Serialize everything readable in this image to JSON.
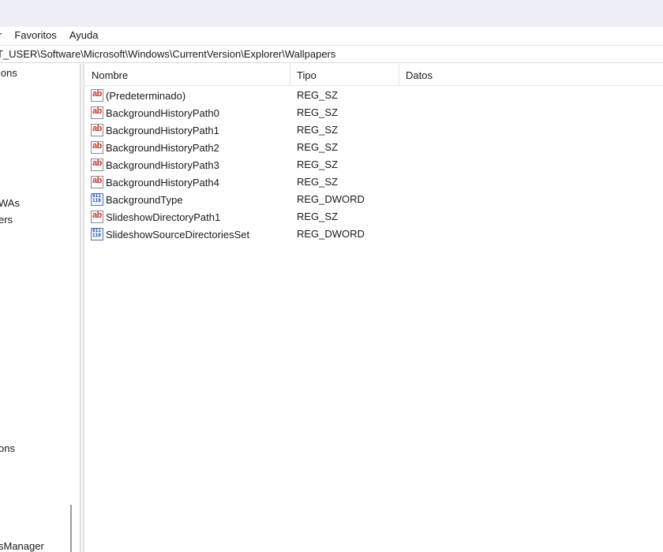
{
  "menu": {
    "items": [
      "r",
      "Favoritos",
      "Ayuda"
    ]
  },
  "address": {
    "path": "T_USER\\Software\\Microsoft\\Windows\\CurrentVersion\\Explorer\\Wallpapers"
  },
  "tree": {
    "items": [
      "ions",
      "WAs",
      "ers",
      "ons",
      "sManager"
    ]
  },
  "list": {
    "headers": {
      "name": "Nombre",
      "type": "Tipo",
      "data": "Datos"
    },
    "rows": [
      {
        "name": "(Predeterminado)",
        "type": "REG_SZ",
        "icon": "string-value-icon"
      },
      {
        "name": "BackgroundHistoryPath0",
        "type": "REG_SZ",
        "icon": "string-value-icon"
      },
      {
        "name": "BackgroundHistoryPath1",
        "type": "REG_SZ",
        "icon": "string-value-icon"
      },
      {
        "name": "BackgroundHistoryPath2",
        "type": "REG_SZ",
        "icon": "string-value-icon"
      },
      {
        "name": "BackgroundHistoryPath3",
        "type": "REG_SZ",
        "icon": "string-value-icon"
      },
      {
        "name": "BackgroundHistoryPath4",
        "type": "REG_SZ",
        "icon": "string-value-icon"
      },
      {
        "name": "BackgroundType",
        "type": "REG_DWORD",
        "icon": "binary-value-icon"
      },
      {
        "name": "SlideshowDirectoryPath1",
        "type": "REG_SZ",
        "icon": "string-value-icon"
      },
      {
        "name": "SlideshowSourceDirectoriesSet",
        "type": "REG_DWORD",
        "icon": "binary-value-icon"
      }
    ]
  },
  "icon_glyphs": {
    "string": "ab",
    "binary": "011\n110"
  },
  "colors": {
    "titlebar": "#eeeef6",
    "string_icon": "#c0392b",
    "binary_icon": "#1f4fa8"
  }
}
